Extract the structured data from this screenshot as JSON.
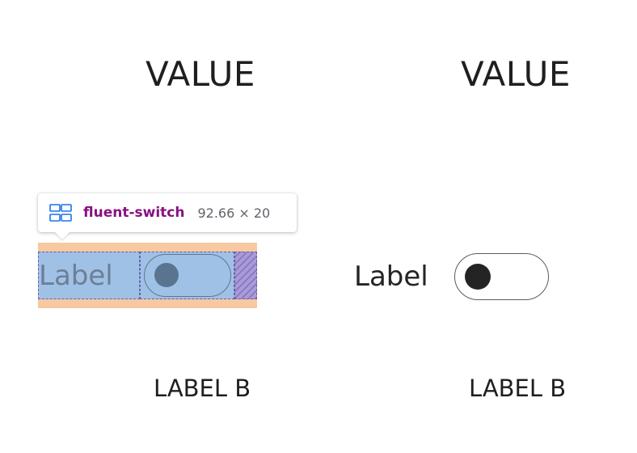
{
  "headings": {
    "left": "VALUE",
    "right": "VALUE"
  },
  "captions": {
    "left": "LABEL B",
    "right": "LABEL B"
  },
  "inspector": {
    "icon": "flex-container-icon",
    "tag": "fluent-switch",
    "dimensions": "92.66 × 20",
    "tag_color": "#881280",
    "margin_color": "#f6c9a0",
    "content_color": "#9fc1e6",
    "gap_color": "#a99bd9"
  },
  "switch_inspected": {
    "label": "Label",
    "checked": false
  },
  "switch_normal": {
    "label": "Label",
    "checked": false
  }
}
